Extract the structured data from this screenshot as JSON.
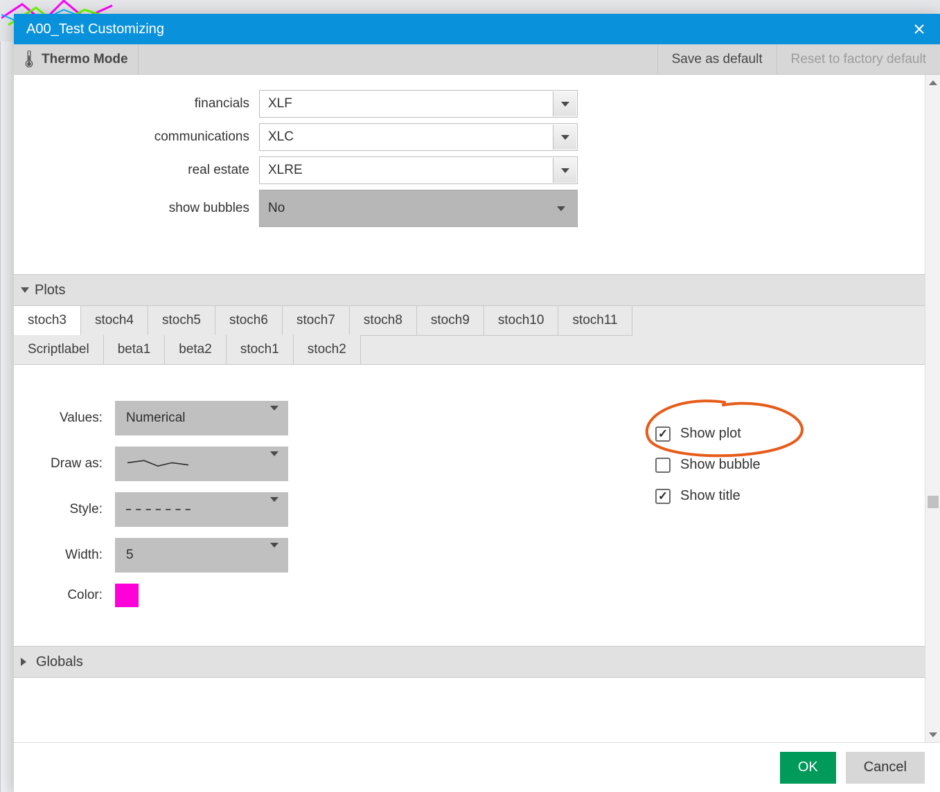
{
  "titlebar": {
    "title": "A00_Test Customizing"
  },
  "toolbar": {
    "thermo": "Thermo Mode",
    "save_default": "Save as default",
    "reset_factory": "Reset to factory default"
  },
  "form": {
    "financials": {
      "label": "financials",
      "value": "XLF"
    },
    "communications": {
      "label": "communications",
      "value": "XLC"
    },
    "real_estate": {
      "label": "real estate",
      "value": "XLRE"
    },
    "show_bubbles": {
      "label": "show bubbles",
      "value": "No"
    }
  },
  "sections": {
    "plots": "Plots",
    "globals": "Globals"
  },
  "tabs": [
    "stoch3",
    "stoch4",
    "stoch5",
    "stoch6",
    "stoch7",
    "stoch8",
    "stoch9",
    "stoch10",
    "stoch11",
    "Scriptlabel",
    "beta1",
    "beta2",
    "stoch1",
    "stoch2"
  ],
  "active_tab": "stoch3",
  "plot": {
    "values": {
      "label": "Values:",
      "value": "Numerical"
    },
    "draw_as": {
      "label": "Draw as:",
      "value": "line"
    },
    "style": {
      "label": "Style:",
      "value": "dashed"
    },
    "width": {
      "label": "Width:",
      "value": "5"
    },
    "color": {
      "label": "Color:",
      "hex": "#ff00d8",
      "style": "background:#ff00d8"
    },
    "show_plot": "Show plot",
    "show_bubble": "Show bubble",
    "show_title": "Show title",
    "show_plot_checked": true,
    "show_bubble_checked": false,
    "show_title_checked": true
  },
  "footer": {
    "ok": "OK",
    "cancel": "Cancel"
  },
  "annotation_color": "#e65c1a"
}
